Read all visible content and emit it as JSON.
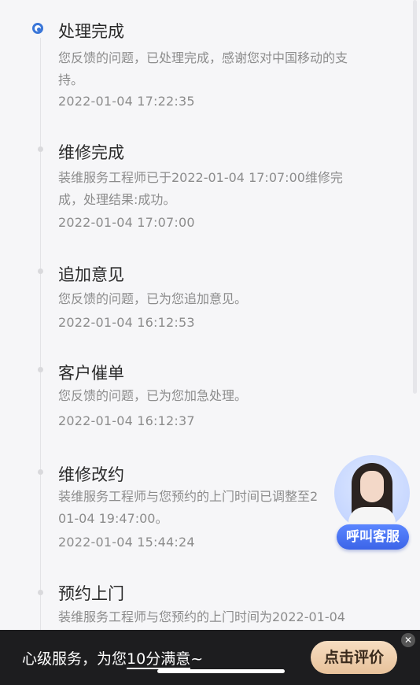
{
  "timeline": {
    "items": [
      {
        "title": "处理完成",
        "desc": [
          "您反馈的问题，已处理完成，感谢您对中国移动的支",
          "持。"
        ],
        "time": "2022-01-04 17:22:35"
      },
      {
        "title": "维修完成",
        "desc": [
          "装维服务工程师已于2022-01-04 17:07:00维修完",
          "成，处理结果:成功。"
        ],
        "time": "2022-01-04 17:07:00"
      },
      {
        "title": "追加意见",
        "desc": [
          "您反馈的问题，已为您追加意见。"
        ],
        "time": "2022-01-04 16:12:53"
      },
      {
        "title": "客户催单",
        "desc": [
          "您反馈的问题，已为您加急处理。"
        ],
        "time": "2022-01-04 16:12:37"
      },
      {
        "title": "维修改约",
        "desc": [
          "装维服务工程师与您预约的上门时间已调整至2",
          "01-04 19:47:00。"
        ],
        "time": "2022-01-04 15:44:24"
      },
      {
        "title": "预约上门",
        "desc": [
          "装维服务工程师与您预约的上门时间为2022-01-04"
        ],
        "time": ""
      }
    ]
  },
  "float_service": {
    "label": "呼叫客服"
  },
  "bottom_bar": {
    "text_before": "心级服务，为您",
    "text_underlined": "10分满意",
    "text_after": "~",
    "rate_button": "点击评价",
    "close_icon": "close-icon"
  },
  "colors": {
    "accent": "#3a76d8",
    "rate_button_bg": "#e8c29b",
    "bottom_bar_bg": "#1d1d1f",
    "service_button": "#4a74f2"
  }
}
